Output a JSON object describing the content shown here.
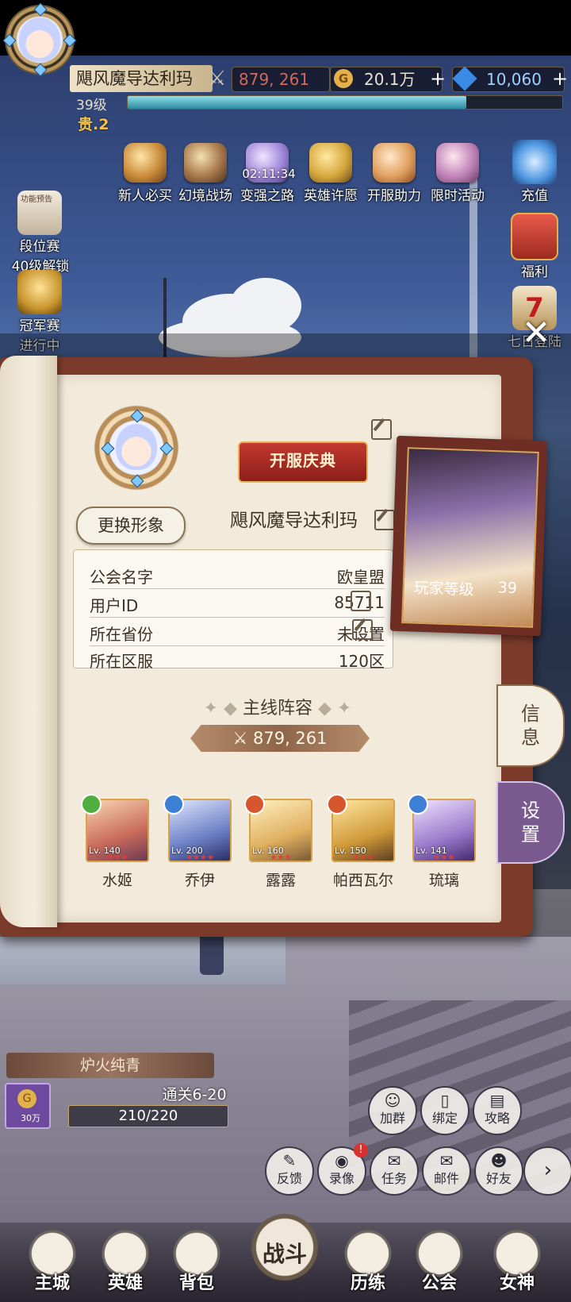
{
  "player": {
    "name": "飓风魔导达利玛",
    "level": "39级",
    "vip": "贵.2",
    "power": "879, 261",
    "gold": "20.1万",
    "diamonds": "10,060",
    "exp_fraction": 0.78
  },
  "events": [
    {
      "label": "新人必买",
      "icon": "gift-pack-icon"
    },
    {
      "label": "幻境战场",
      "icon": "battlefield-icon"
    },
    {
      "label": "变强之路",
      "icon": "growth-road-icon",
      "timer": "02:11:34"
    },
    {
      "label": "英雄许愿",
      "icon": "hero-wish-icon"
    },
    {
      "label": "开服助力",
      "icon": "server-boost-icon"
    },
    {
      "label": "限时活动",
      "icon": "limited-event-icon"
    }
  ],
  "left_side": [
    {
      "label": "段位赛",
      "sub": "40级解锁",
      "banner": "功能预告"
    },
    {
      "label": "冠军赛",
      "sub": "进行中"
    }
  ],
  "right_side": [
    "充值",
    "福利",
    "七日登陆"
  ],
  "profile": {
    "change_look": "更换形象",
    "banner": "开服庆典",
    "name": "飓风魔导达利玛",
    "info": [
      {
        "key": "公会名字",
        "value": "欧皇盟"
      },
      {
        "key": "用户ID",
        "value": "85711"
      },
      {
        "key": "所在省份",
        "value": "未设置"
      },
      {
        "key": "所在区服",
        "value": "120区"
      }
    ],
    "player_level_label": "玩家等级",
    "player_level_value": "39",
    "lineup_title": "主线阵容",
    "lineup_power": "879, 261",
    "heroes": [
      {
        "name": "水姬",
        "lv": "Lv. 140",
        "stars": "★★★"
      },
      {
        "name": "乔伊",
        "lv": "Lv. 200",
        "stars": "★★★★"
      },
      {
        "name": "露露",
        "lv": "Lv. 160",
        "stars": "★★★"
      },
      {
        "name": "帕西瓦尔",
        "lv": "Lv. 150",
        "stars": "★★★"
      },
      {
        "name": "琉璃",
        "lv": "Lv. 141",
        "stars": "★★★"
      }
    ],
    "tabs": [
      "信息",
      "设置"
    ]
  },
  "stage": {
    "zone_name": "炉火纯青",
    "reward": "30万",
    "clear_text": "通关6-20",
    "progress_text": "210/220"
  },
  "quick_buttons": [
    {
      "label": "加群",
      "icon": "qq-icon"
    },
    {
      "label": "绑定",
      "icon": "phone-icon"
    },
    {
      "label": "攻略",
      "icon": "book-icon"
    },
    {
      "label": "反馈",
      "icon": "feedback-icon"
    },
    {
      "label": "录像",
      "icon": "camera-icon"
    },
    {
      "label": "任务",
      "icon": "scroll-icon"
    },
    {
      "label": "邮件",
      "icon": "mail-icon"
    },
    {
      "label": "好友",
      "icon": "friends-icon"
    }
  ],
  "nav": [
    "主城",
    "英雄",
    "背包",
    "战斗",
    "历练",
    "公会",
    "女神"
  ]
}
